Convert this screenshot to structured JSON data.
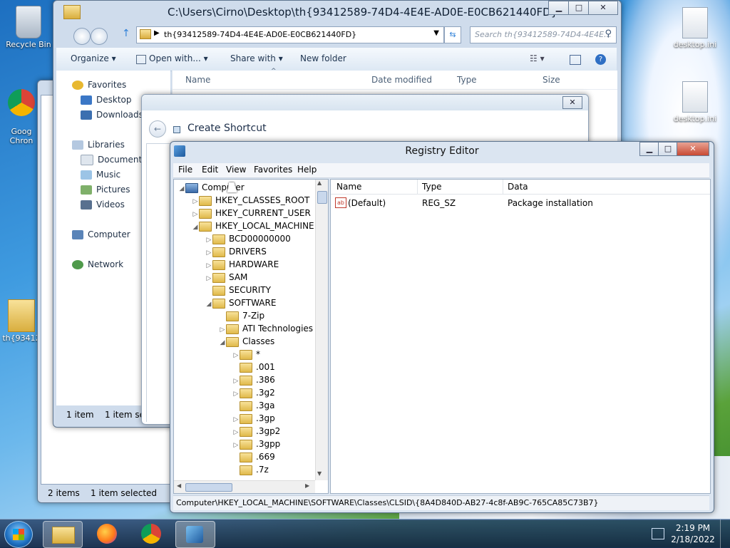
{
  "desktop": {
    "icons": [
      {
        "label": "Recycle Bin"
      },
      {
        "label": "Goog\nChron"
      },
      {
        "label": "th{93412"
      },
      {
        "label": "desktop.ini"
      },
      {
        "label": "desktop.ini"
      }
    ]
  },
  "explorer": {
    "title": "C:\\Users\\Cirno\\Desktop\\th{93412589-74D4-4E4E-AD0E-E0CB621440FD}",
    "address": "th{93412589-74D4-4E4E-AD0E-E0CB621440FD}",
    "search_placeholder": "Search th{93412589-74D4-4E4E...",
    "toolbar": {
      "organize": "Organize ▾",
      "open_with": "Open with... ▾",
      "share_with": "Share with ▾",
      "new_folder": "New folder"
    },
    "columns": {
      "name": "Name",
      "date": "Date modified",
      "type": "Type",
      "size": "Size"
    },
    "nav": {
      "favorites": "Favorites",
      "desktop": "Desktop",
      "downloads": "Downloads",
      "libraries": "Libraries",
      "documents": "Documents",
      "music": "Music",
      "pictures": "Pictures",
      "videos": "Videos",
      "computer": "Computer",
      "network": "Network"
    },
    "status_count": "1 item",
    "status_selected": "1 item sel",
    "back_status_count": "2 items",
    "back_status_selected": "1 item selected"
  },
  "shortcut": {
    "title": "Create Shortcut"
  },
  "regedit": {
    "title": "Registry Editor",
    "menu": [
      "File",
      "Edit",
      "View",
      "Favorites",
      "Help"
    ],
    "tree": [
      {
        "label": "Computer",
        "depth": 0,
        "exp": "◢"
      },
      {
        "label": "HKEY_CLASSES_ROOT",
        "depth": 1,
        "exp": "▷"
      },
      {
        "label": "HKEY_CURRENT_USER",
        "depth": 1,
        "exp": "▷"
      },
      {
        "label": "HKEY_LOCAL_MACHINE",
        "depth": 1,
        "exp": "◢"
      },
      {
        "label": "BCD00000000",
        "depth": 2,
        "exp": "▷"
      },
      {
        "label": "DRIVERS",
        "depth": 2,
        "exp": "▷"
      },
      {
        "label": "HARDWARE",
        "depth": 2,
        "exp": "▷"
      },
      {
        "label": "SAM",
        "depth": 2,
        "exp": "▷"
      },
      {
        "label": "SECURITY",
        "depth": 2,
        "exp": ""
      },
      {
        "label": "SOFTWARE",
        "depth": 2,
        "exp": "◢"
      },
      {
        "label": "7-Zip",
        "depth": 3,
        "exp": ""
      },
      {
        "label": "ATI Technologies",
        "depth": 3,
        "exp": "▷"
      },
      {
        "label": "Classes",
        "depth": 3,
        "exp": "◢"
      },
      {
        "label": "*",
        "depth": 4,
        "exp": "▷"
      },
      {
        "label": ".001",
        "depth": 4,
        "exp": ""
      },
      {
        "label": ".386",
        "depth": 4,
        "exp": "▷"
      },
      {
        "label": ".3g2",
        "depth": 4,
        "exp": "▷"
      },
      {
        "label": ".3ga",
        "depth": 4,
        "exp": ""
      },
      {
        "label": ".3gp",
        "depth": 4,
        "exp": "▷"
      },
      {
        "label": ".3gp2",
        "depth": 4,
        "exp": "▷"
      },
      {
        "label": ".3gpp",
        "depth": 4,
        "exp": "▷"
      },
      {
        "label": ".669",
        "depth": 4,
        "exp": ""
      },
      {
        "label": ".7z",
        "depth": 4,
        "exp": ""
      }
    ],
    "columns": {
      "name": "Name",
      "type": "Type",
      "data": "Data"
    },
    "values": [
      {
        "name": "(Default)",
        "type": "REG_SZ",
        "data": "Package installation"
      }
    ],
    "status_path": "Computer\\HKEY_LOCAL_MACHINE\\SOFTWARE\\Classes\\CLSID\\{8A4D840D-AB27-4c8f-AB9C-765CA85C73B7}"
  },
  "taskbar": {
    "time": "2:19 PM",
    "date": "2/18/2022"
  }
}
